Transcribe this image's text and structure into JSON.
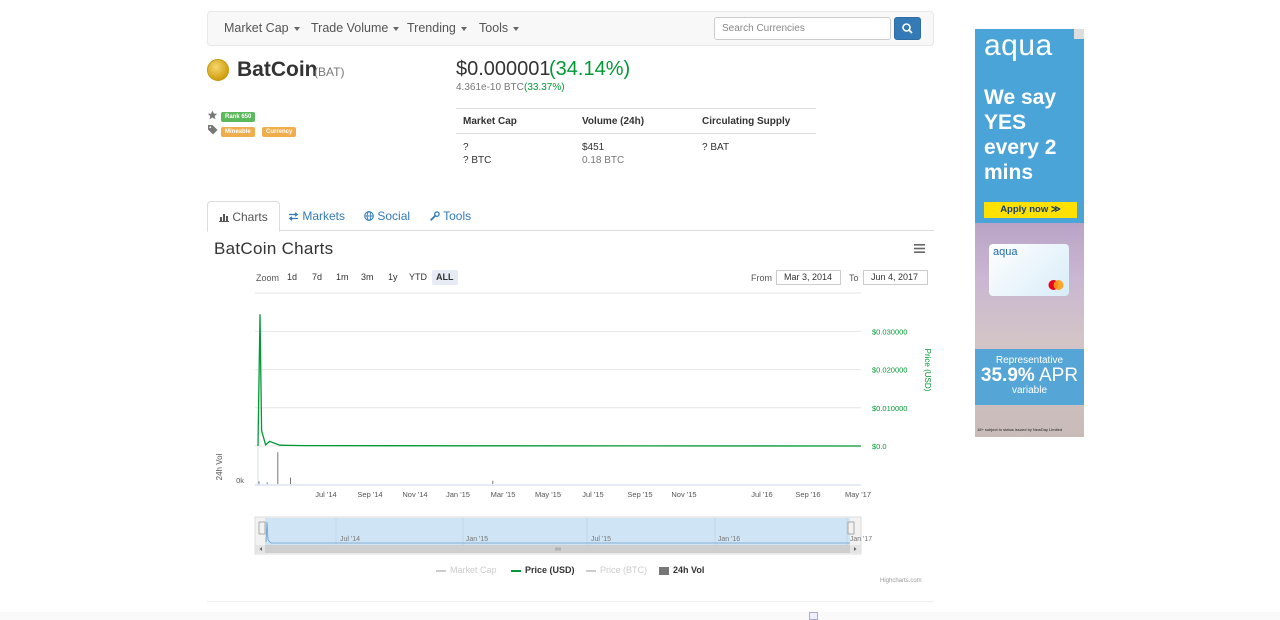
{
  "nav": {
    "items": [
      "Market Cap",
      "Trade Volume",
      "Trending",
      "Tools"
    ],
    "search_placeholder": "Search Currencies"
  },
  "coin": {
    "name": "BatCoin",
    "symbol": "(BAT)",
    "rank": "Rank 650",
    "tags": [
      "Mineable",
      "Currency"
    ],
    "price_usd": "$0.000001",
    "price_change": "(34.14%)",
    "price_btc": "4.361e-10 BTC",
    "price_btc_change": "(33.37%)"
  },
  "stats": {
    "headers": [
      "Market Cap",
      "Volume (24h)",
      "Circulating Supply"
    ],
    "market_cap_usd": "?",
    "market_cap_btc": "? BTC",
    "volume_usd": "$451",
    "volume_btc": "0.18 BTC",
    "supply": "? BAT"
  },
  "tabs": [
    "Charts",
    "Markets",
    "Social",
    "Tools"
  ],
  "chart": {
    "title": "BatCoin Charts",
    "zoom_label": "Zoom",
    "zoom_options": [
      "1d",
      "7d",
      "1m",
      "3m",
      "1y",
      "YTD",
      "ALL"
    ],
    "selected_zoom": "ALL",
    "from_label": "From",
    "from_date": "Mar 3, 2014",
    "to_label": "To",
    "to_date": "Jun 4, 2017",
    "credits": "Highcharts.com",
    "legend": [
      {
        "name": "Market Cap",
        "color": "#cccccc",
        "active": false
      },
      {
        "name": "Price (USD)",
        "color": "#009933",
        "active": true
      },
      {
        "name": "Price (BTC)",
        "color": "#cccccc",
        "active": false
      },
      {
        "name": "24h Vol",
        "color": "#777777",
        "active": true
      }
    ],
    "colors": {
      "price": "#009933",
      "volume": "#777777",
      "navigator_fill": "#cfe4f5"
    }
  },
  "chart_data": {
    "type": "line",
    "title": "BatCoin Charts",
    "ylabel": "Price (USD)",
    "ylabel_volume": "24h Vol",
    "y_ticks": [
      "$0.0",
      "$0.010000",
      "$0.020000",
      "$0.030000"
    ],
    "ylim": [
      0,
      0.035
    ],
    "volume_ticks": [
      "0k"
    ],
    "x_ticks": [
      "Jul '14",
      "Sep '14",
      "Nov '14",
      "Jan '15",
      "Mar '15",
      "May '15",
      "Jul '15",
      "Sep '15",
      "Nov '15",
      "Jul '16",
      "Sep '16",
      "May '17"
    ],
    "navigator_ticks": [
      "Jul '14",
      "Jan '15",
      "Jul '15",
      "Jan '16",
      "Jan '17"
    ],
    "grid": true,
    "legend": "bottom",
    "series": [
      {
        "name": "Price (USD)",
        "x": [
          "2014-03-03",
          "2014-03-07",
          "2014-03-10",
          "2014-03-18",
          "2014-03-26",
          "2014-04-15",
          "2014-06-01",
          "2015-06-01",
          "2017-06-04"
        ],
        "values": [
          0.0,
          0.0345,
          0.004,
          0.0003,
          0.0012,
          0.0002,
          0.0001,
          5e-05,
          1e-06
        ]
      },
      {
        "name": "24h Vol",
        "x": [
          "2014-03-04",
          "2014-03-20",
          "2014-04-10",
          "2014-05-05",
          "2015-06-08"
        ],
        "values": [
          0.5,
          0.3,
          6.0,
          1.2,
          0.6
        ]
      }
    ]
  }
}
